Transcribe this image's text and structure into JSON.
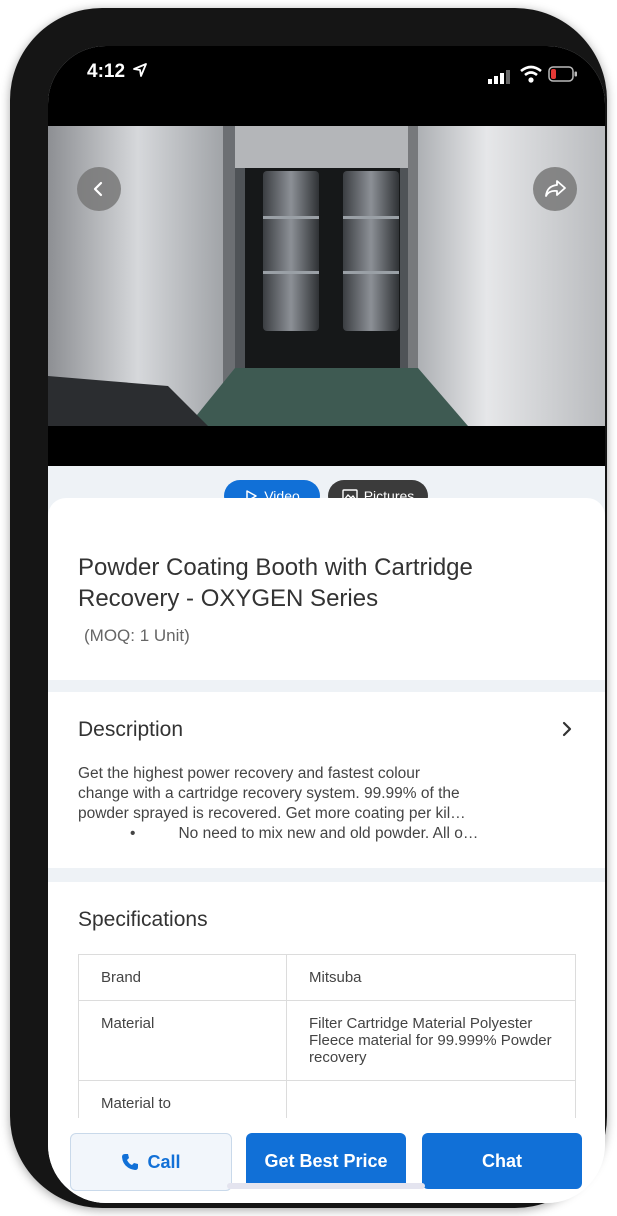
{
  "status_bar": {
    "time": "4:12"
  },
  "media": {
    "tabs": [
      {
        "label": "Video",
        "active": true
      },
      {
        "label": "Pictures",
        "active": false
      }
    ]
  },
  "product": {
    "title": "Powder Coating Booth with Cartridge Recovery - OXYGEN Series",
    "moq": "(MOQ: 1 Unit)"
  },
  "description": {
    "heading": "Description",
    "lines": [
      "Get the highest power recovery and fastest colour",
      "change with a cartridge recovery system. 99.99% of the",
      "powder sprayed is recovered. Get more coating per kil…",
      "•          No need to mix new and old powder. All o…"
    ]
  },
  "specifications": {
    "heading": "Specifications",
    "rows": [
      {
        "label": "Brand",
        "value": "Mitsuba"
      },
      {
        "label": "Material",
        "value": "Filter Cartridge Material Polyester Fleece material for 99.999% Powder recovery"
      },
      {
        "label": "Material to",
        "value": ""
      }
    ]
  },
  "actions": {
    "call": "Call",
    "get_best_price": "Get Best Price",
    "chat": "Chat"
  },
  "colors": {
    "accent": "#1170d7",
    "text": "#333333"
  }
}
